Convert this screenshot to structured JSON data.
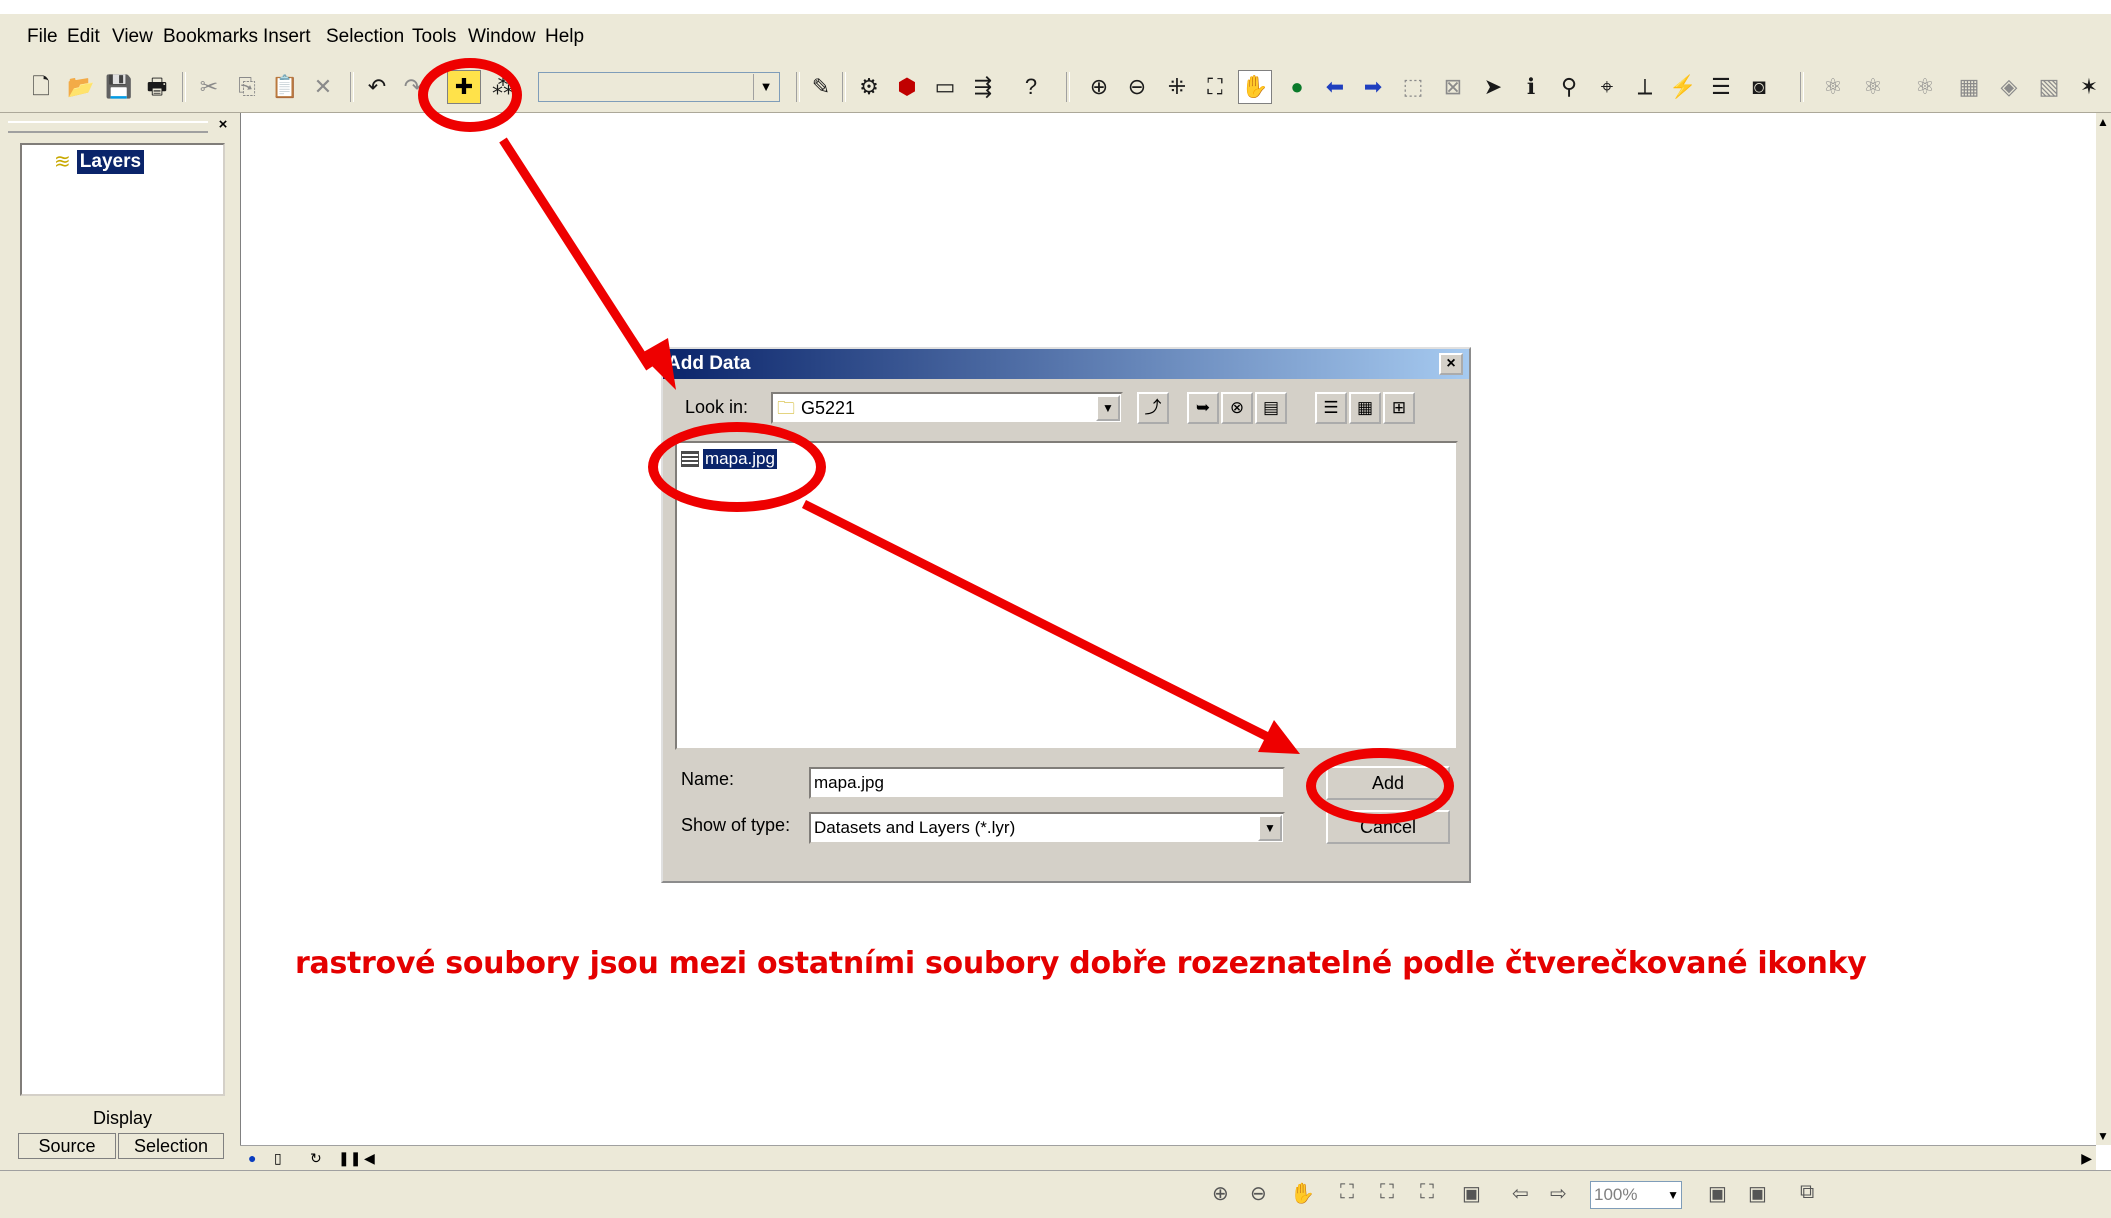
{
  "menubar": {
    "items": [
      "File",
      "Edit",
      "View",
      "Bookmarks",
      "Insert",
      "Selection",
      "Tools",
      "Window",
      "Help"
    ]
  },
  "toolbar": {
    "icons": [
      "new-document-icon",
      "open-folder-icon",
      "save-icon",
      "print-icon",
      "cut-icon",
      "copy-icon",
      "paste-icon",
      "delete-icon",
      "undo-icon",
      "redo-icon",
      "add-data-icon",
      "add-xy-data-icon",
      "editor-icon",
      "arctoolbox-icon",
      "model-builder-icon",
      "map-window-icon",
      "connect-icon",
      "whats-this-icon",
      "zoom-in-icon",
      "zoom-out-icon",
      "fixed-zoom-in-icon",
      "fixed-zoom-out-icon",
      "pan-icon",
      "full-extent-icon",
      "go-back-icon",
      "go-forward-icon",
      "select-features-icon",
      "clear-selection-icon",
      "select-elements-icon",
      "identify-icon",
      "find-icon",
      "go-to-xy-icon",
      "measure-icon",
      "hyperlink-icon",
      "html-popup-icon",
      "time-slider-icon"
    ],
    "combo_value": ""
  },
  "toc": {
    "root_label": "Layers",
    "tab_display": "Display",
    "tab_source": "Source",
    "tab_selection": "Selection"
  },
  "statusbar": {
    "zoom": "100%"
  },
  "dialog": {
    "title": "Add Data",
    "look_in_label": "Look in:",
    "look_in_value": "G5221",
    "file_name_item": "mapa.jpg",
    "name_label": "Name:",
    "name_value": "mapa.jpg",
    "type_label": "Show of type:",
    "type_value": "Datasets and Layers (*.lyr)",
    "add_button": "Add",
    "cancel_button": "Cancel"
  },
  "annotation": {
    "caption": "rastrové soubory jsou mezi ostatními soubory dobře rozeznatelné podle čtverečkované ikonky",
    "color": "#ee0000"
  }
}
